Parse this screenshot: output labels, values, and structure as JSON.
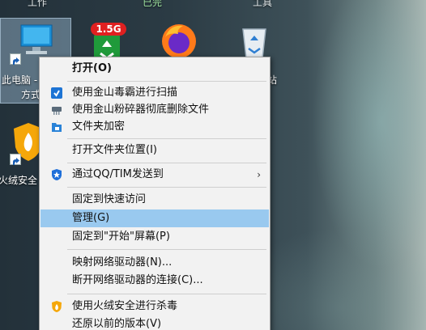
{
  "desktop": {
    "top_labels": [
      "工作",
      "已完",
      "工具"
    ],
    "icons": [
      {
        "label_line1": "此电脑 -",
        "label_line2": "方式"
      },
      {
        "label": "1.5G"
      },
      {
        "label": ""
      },
      {
        "label": "站"
      },
      {
        "label": "火绒安全"
      }
    ]
  },
  "context_menu": {
    "items": [
      {
        "label": "打开(O)"
      },
      {
        "label": "使用金山毒霸进行扫描"
      },
      {
        "label": "使用金山粉碎器彻底删除文件"
      },
      {
        "label": "文件夹加密"
      },
      {
        "label": "打开文件夹位置(I)"
      },
      {
        "label": "通过QQ/TIM发送到",
        "submenu_arrow": "›"
      },
      {
        "label": "固定到快速访问"
      },
      {
        "label": "管理(G)"
      },
      {
        "label": "固定到\"开始\"屏幕(P)"
      },
      {
        "label": "映射网络驱动器(N)..."
      },
      {
        "label": "断开网络驱动器的连接(C)..."
      },
      {
        "label": "使用火绒安全进行杀毒"
      },
      {
        "label": "还原以前的版本(V)"
      }
    ]
  },
  "colors": {
    "menu_bg": "#f2f2f2",
    "highlight": "#99c9ef",
    "separator": "#cfcfcf"
  }
}
